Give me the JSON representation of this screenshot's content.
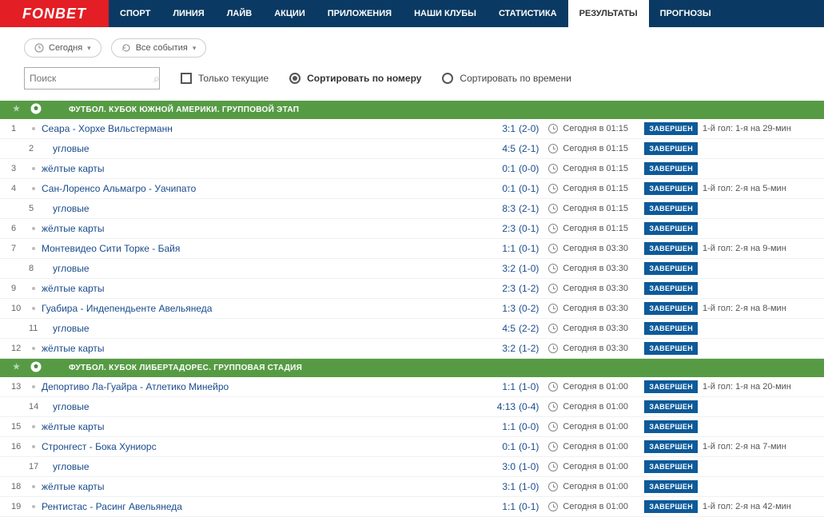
{
  "brand": "FONBET",
  "nav": {
    "items": [
      {
        "label": "СПОРТ",
        "active": false
      },
      {
        "label": "ЛИНИЯ",
        "active": false
      },
      {
        "label": "ЛАЙВ",
        "active": false
      },
      {
        "label": "АКЦИИ",
        "active": false
      },
      {
        "label": "ПРИЛОЖЕНИЯ",
        "active": false
      },
      {
        "label": "НАШИ КЛУБЫ",
        "active": false
      },
      {
        "label": "СТАТИСТИКА",
        "active": false
      },
      {
        "label": "РЕЗУЛЬТАТЫ",
        "active": true
      },
      {
        "label": "ПРОГНОЗЫ",
        "active": false
      }
    ]
  },
  "filters": {
    "today_label": "Сегодня",
    "all_events_label": "Все события"
  },
  "search": {
    "placeholder": "Поиск"
  },
  "options": {
    "only_current_label": "Только текущие",
    "sort_by_number_label": "Сортировать по номеру",
    "sort_by_time_label": "Сортировать по времени",
    "sort_selected": "number"
  },
  "status_badge": "ЗАВЕРШЕН",
  "competitions": [
    {
      "title": "ФУТБОЛ. КУБОК ЮЖНОЙ АМЕРИКИ. ГРУППОВОЙ ЭТАП",
      "events": [
        {
          "num": "1",
          "name": "Сеара - Хорхе Вильстерманн",
          "score": "3:1",
          "paren": "(2-0)",
          "time": "Сегодня в 01:15",
          "extra": "1-й гол: 1-я на 29-мин",
          "sub": false
        },
        {
          "num": "2",
          "name": "угловые",
          "score": "4:5",
          "paren": "(2-1)",
          "time": "Сегодня в 01:15",
          "extra": "",
          "sub": true
        },
        {
          "num": "3",
          "name": "жёлтые карты",
          "score": "0:1",
          "paren": "(0-0)",
          "time": "Сегодня в 01:15",
          "extra": "",
          "sub": false
        },
        {
          "num": "4",
          "name": "Сан-Лоренсо Альмагро - Уачипато",
          "score": "0:1",
          "paren": "(0-1)",
          "time": "Сегодня в 01:15",
          "extra": "1-й гол: 2-я на 5-мин",
          "sub": false
        },
        {
          "num": "5",
          "name": "угловые",
          "score": "8:3",
          "paren": "(2-1)",
          "time": "Сегодня в 01:15",
          "extra": "",
          "sub": true
        },
        {
          "num": "6",
          "name": "жёлтые карты",
          "score": "2:3",
          "paren": "(0-1)",
          "time": "Сегодня в 01:15",
          "extra": "",
          "sub": false
        },
        {
          "num": "7",
          "name": "Монтевидео Сити Торке - Байя",
          "score": "1:1",
          "paren": "(0-1)",
          "time": "Сегодня в 03:30",
          "extra": "1-й гол: 2-я на 9-мин",
          "sub": false
        },
        {
          "num": "8",
          "name": "угловые",
          "score": "3:2",
          "paren": "(1-0)",
          "time": "Сегодня в 03:30",
          "extra": "",
          "sub": true
        },
        {
          "num": "9",
          "name": "жёлтые карты",
          "score": "2:3",
          "paren": "(1-2)",
          "time": "Сегодня в 03:30",
          "extra": "",
          "sub": false
        },
        {
          "num": "10",
          "name": "Гуабира - Индепендьенте Авельянеда",
          "score": "1:3",
          "paren": "(0-2)",
          "time": "Сегодня в 03:30",
          "extra": "1-й гол: 2-я на 8-мин",
          "sub": false
        },
        {
          "num": "11",
          "name": "угловые",
          "score": "4:5",
          "paren": "(2-2)",
          "time": "Сегодня в 03:30",
          "extra": "",
          "sub": true
        },
        {
          "num": "12",
          "name": "жёлтые карты",
          "score": "3:2",
          "paren": "(1-2)",
          "time": "Сегодня в 03:30",
          "extra": "",
          "sub": false
        }
      ]
    },
    {
      "title": "ФУТБОЛ. КУБОК ЛИБЕРТАДОРЕС. ГРУППОВАЯ СТАДИЯ",
      "events": [
        {
          "num": "13",
          "name": "Депортиво Ла-Гуайра - Атлетико Минейро",
          "score": "1:1",
          "paren": "(1-0)",
          "time": "Сегодня в 01:00",
          "extra": "1-й гол: 1-я на 20-мин",
          "sub": false
        },
        {
          "num": "14",
          "name": "угловые",
          "score": "4:13",
          "paren": "(0-4)",
          "time": "Сегодня в 01:00",
          "extra": "",
          "sub": true
        },
        {
          "num": "15",
          "name": "жёлтые карты",
          "score": "1:1",
          "paren": "(0-0)",
          "time": "Сегодня в 01:00",
          "extra": "",
          "sub": false
        },
        {
          "num": "16",
          "name": "Стронгест - Бока Хуниорс",
          "score": "0:1",
          "paren": "(0-1)",
          "time": "Сегодня в 01:00",
          "extra": "1-й гол: 2-я на 7-мин",
          "sub": false
        },
        {
          "num": "17",
          "name": "угловые",
          "score": "3:0",
          "paren": "(1-0)",
          "time": "Сегодня в 01:00",
          "extra": "",
          "sub": true
        },
        {
          "num": "18",
          "name": "жёлтые карты",
          "score": "3:1",
          "paren": "(1-0)",
          "time": "Сегодня в 01:00",
          "extra": "",
          "sub": false
        },
        {
          "num": "19",
          "name": "Рентистас - Расинг Авельянеда",
          "score": "1:1",
          "paren": "(0-1)",
          "time": "Сегодня в 01:00",
          "extra": "1-й гол: 2-я на 42-мин",
          "sub": false
        }
      ]
    }
  ]
}
